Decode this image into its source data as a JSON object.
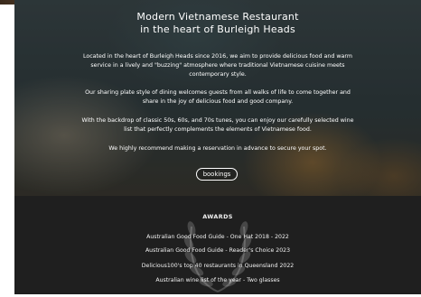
{
  "hero": {
    "title_line1": "Modern Vietnamese Restaurant",
    "title_line2": "in the heart of Burleigh Heads",
    "paragraphs": [
      {
        "line1": "Located in the heart of Burleigh Heads since 2016, we aim to provide delicious food and warm",
        "line2": "service in a lively and \"buzzing\" atmosphere where traditional Vietnamese cuisine meets",
        "line3": "contemporary style."
      },
      {
        "line1": "Our sharing plate style of dining welcomes guests from all walks of life to come together and",
        "line2": "share in the joy of delicious food and good company."
      },
      {
        "line1": "With the backdrop of classic 50s, 60s, and 70s tunes, you can enjoy our carefully selected wine",
        "line2": "list that perfectly complements the elements of Vietnamese food."
      },
      {
        "line1": "We highly recommend making a reservation in advance to secure your spot."
      }
    ],
    "bookings_button": "bookings"
  },
  "awards": {
    "heading": "AWARDS",
    "items": [
      "Australian Good Food Guide - One Hat 2018 - 2022",
      "Australian Good Food Guide - Reader's Choice 2023",
      "Delicious100's top 40 restaurants in Queensland 2022",
      "Australian wine list of the year - Two glasses"
    ]
  },
  "icons": {
    "laurel": "laurel-wreath-icon"
  },
  "colors": {
    "awards_bg": "#1f1f1f",
    "hero_overlay": "#2c3436",
    "text": "#ffffff"
  }
}
